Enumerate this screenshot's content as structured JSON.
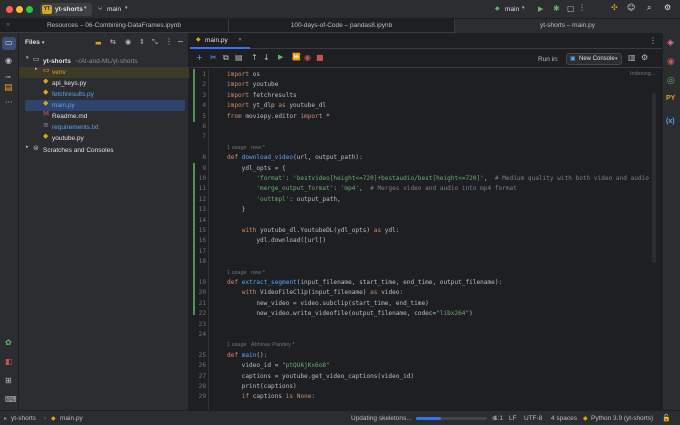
{
  "titlebar": {
    "project": "yt-shorts",
    "project_badge": "YT",
    "branch": "main",
    "run_config": "main"
  },
  "tabs": [
    "Resources – 06-Combining-DataFrames.ipynb",
    "100-days-of-Code – pandas8.ipynb",
    "yt-shorts – main.py"
  ],
  "project_panel": {
    "title": "Files",
    "tree": [
      {
        "name": "yt-shorts",
        "path": "~/AI-and-ML/yt-shorts",
        "kind": "root"
      },
      {
        "name": "venv",
        "kind": "folder"
      },
      {
        "name": "api_keys.py",
        "kind": "py"
      },
      {
        "name": "fetchresults.py",
        "kind": "py"
      },
      {
        "name": "main.py",
        "kind": "py"
      },
      {
        "name": "Readme.md",
        "kind": "md"
      },
      {
        "name": "requirements.txt",
        "kind": "txt"
      },
      {
        "name": "youtube.py",
        "kind": "py"
      },
      {
        "name": "Scratches and Consoles",
        "kind": "scratch"
      }
    ]
  },
  "editor": {
    "file_tab": "main.py",
    "run_in_label": "Run in:",
    "run_in_value": "New Console",
    "indexing": "Indexing...",
    "lines": [
      {
        "n": "1",
        "t": "import os"
      },
      {
        "n": "2",
        "t": "import youtube"
      },
      {
        "n": "3",
        "t": "import fetchresults"
      },
      {
        "n": "4",
        "t": "import yt_dlp as youtube_dl"
      },
      {
        "n": "5",
        "t": "from moviepy.editor import *"
      },
      {
        "n": "6",
        "t": ""
      },
      {
        "n": "7",
        "t": ""
      },
      {
        "n": "",
        "t": "1 usage   new *",
        "hint": true
      },
      {
        "n": "8",
        "t": "def download_video(url, output_path):"
      },
      {
        "n": "9",
        "t": "    ydl_opts = {"
      },
      {
        "n": "10",
        "t": "        'format': 'bestvideo[height<=720]+bestaudio/best[height<=720]',  # Medium quality with both video and audio"
      },
      {
        "n": "11",
        "t": "        'merge_output_format': 'mp4',  # Merges video and audio into mp4 format"
      },
      {
        "n": "12",
        "t": "        'outtmpl': output_path,"
      },
      {
        "n": "13",
        "t": "    }"
      },
      {
        "n": "14",
        "t": ""
      },
      {
        "n": "15",
        "t": "    with youtube_dl.YoutubeDL(ydl_opts) as ydl:"
      },
      {
        "n": "16",
        "t": "        ydl.download([url])"
      },
      {
        "n": "17",
        "t": ""
      },
      {
        "n": "18",
        "t": ""
      },
      {
        "n": "",
        "t": "1 usage   new *",
        "hint": true
      },
      {
        "n": "19",
        "t": "def extract_segment(input_filename, start_time, end_time, output_filename):"
      },
      {
        "n": "20",
        "t": "    with VideoFileClip(input_filename) as video:"
      },
      {
        "n": "21",
        "t": "        new_video = video.subclip(start_time, end_time)"
      },
      {
        "n": "22",
        "t": "        new_video.write_videofile(output_filename, codec=\"libx264\")"
      },
      {
        "n": "23",
        "t": ""
      },
      {
        "n": "24",
        "t": ""
      },
      {
        "n": "",
        "t": "1 usage   Abhinav Pandey *",
        "hint": true
      },
      {
        "n": "25",
        "t": "def main():"
      },
      {
        "n": "26",
        "t": "    video_id = \"ptQUAjKx6o8\""
      },
      {
        "n": "27",
        "t": "    captions = youtube.get_video_captions(video_id)"
      },
      {
        "n": "28",
        "t": "    print(captions)"
      },
      {
        "n": "29",
        "t": "    if captions is None:"
      }
    ]
  },
  "statusbar": {
    "crumb_project": "yt-shorts",
    "crumb_file": "main.py",
    "progress_text": "Updating skeletons...",
    "progress_fraction": 0.35,
    "position": "1:1",
    "line_sep": "LF",
    "encoding": "UTF-8",
    "indent": "4 spaces",
    "interpreter": "Python 3.9 (yt-shorts)"
  },
  "colors": {
    "accent": "#3574f0",
    "project_badge": "#d6a61d",
    "green_change": "#549159"
  }
}
